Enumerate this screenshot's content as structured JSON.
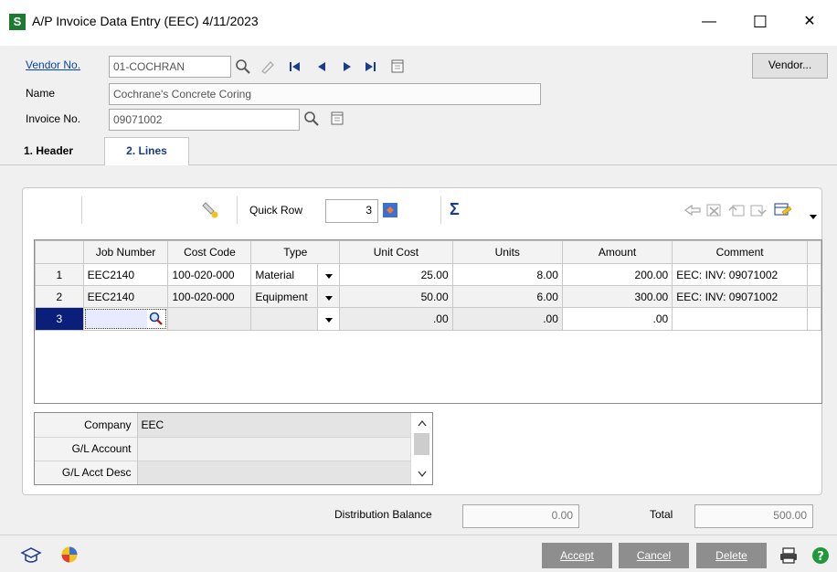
{
  "window": {
    "app_icon": "S",
    "title": "A/P Invoice Data Entry (EEC) 4/11/2023",
    "minimize": "—",
    "maximize": "☐",
    "close": "✕"
  },
  "form": {
    "vendor_label": "Vendor No.",
    "vendor_value": "01-COCHRAN",
    "name_label": "Name",
    "name_value": "Cochrane's Concrete Coring",
    "invoice_label": "Invoice No.",
    "invoice_value": "09071002",
    "vendor_button": "Vendor..."
  },
  "tabs": [
    {
      "label": "1. Header"
    },
    {
      "label": "2. Lines"
    }
  ],
  "toolbar": {
    "quick_row_label": "Quick Row",
    "quick_row_value": "3"
  },
  "grid": {
    "columns": [
      "",
      "Job Number",
      "Cost Code",
      "Type",
      "",
      "Unit Cost",
      "Units",
      "Amount",
      "Comment"
    ],
    "rows": [
      {
        "n": "1",
        "job": "EEC2140",
        "cost_code": "100-020-000",
        "type": "Material",
        "unit_cost": "25.00",
        "units": "8.00",
        "amount": "200.00",
        "comment": "EEC: INV: 09071002"
      },
      {
        "n": "2",
        "job": "EEC2140",
        "cost_code": "100-020-000",
        "type": "Equipment",
        "unit_cost": "50.00",
        "units": "6.00",
        "amount": "300.00",
        "comment": "EEC: INV: 09071002"
      },
      {
        "n": "3",
        "job": "",
        "cost_code": "",
        "type": "",
        "unit_cost": ".00",
        "units": ".00",
        "amount": ".00",
        "comment": ""
      }
    ]
  },
  "details": [
    {
      "label": "Company",
      "value": "EEC"
    },
    {
      "label": "G/L Account",
      "value": ""
    },
    {
      "label": "G/L Acct Desc",
      "value": ""
    }
  ],
  "totals": {
    "distribution_label": "Distribution Balance",
    "distribution_value": "0.00",
    "total_label": "Total",
    "total_value": "500.00"
  },
  "buttons": {
    "accept": "Accept",
    "cancel": "Cancel",
    "delete": "Delete"
  },
  "colors": {
    "selected_row": "#0a1f7a",
    "app_icon": "#1c7a32",
    "footer_button": "#8e8e8e"
  }
}
